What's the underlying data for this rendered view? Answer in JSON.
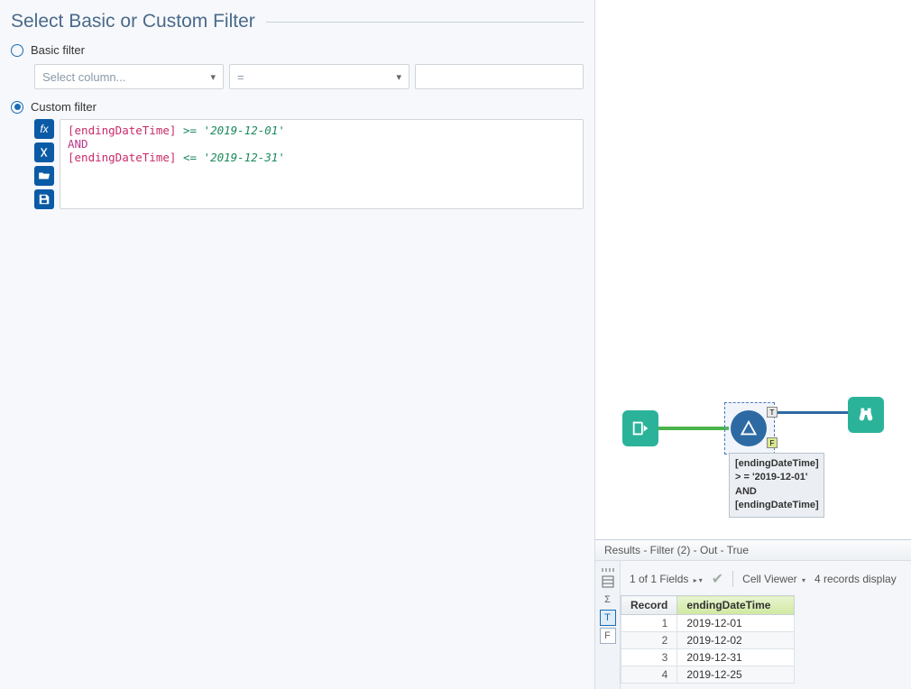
{
  "panel": {
    "title": "Select Basic or Custom Filter",
    "basic_label": "Basic filter",
    "custom_label": "Custom filter",
    "column_placeholder": "Select column...",
    "operator_value": "="
  },
  "expression": {
    "line1_field": "[endingDateTime]",
    "line1_op": ">=",
    "line1_val": "'2019-12-01'",
    "keyword": "AND",
    "line2_field": "[endingDateTime]",
    "line2_op": "<=",
    "line2_val": "'2019-12-31'"
  },
  "tools": {
    "fx": "fx",
    "x": "X",
    "t_anchor": "T",
    "f_anchor": "F"
  },
  "tooltip": {
    "l1": "[endingDateTime]",
    "l2": "> = '2019-12-01'",
    "l3": "AND",
    "l4": "[endingDateTime]"
  },
  "results": {
    "header": "Results - Filter (2) - Out - True",
    "fields_label": "1 of 1 Fields",
    "cell_viewer": "Cell Viewer",
    "records_info": "4 records display",
    "col_record": "Record",
    "col_ending": "endingDateTime",
    "rows": [
      {
        "n": "1",
        "v": "2019-12-01"
      },
      {
        "n": "2",
        "v": "2019-12-02"
      },
      {
        "n": "3",
        "v": "2019-12-31"
      },
      {
        "n": "4",
        "v": "2019-12-25"
      }
    ]
  }
}
